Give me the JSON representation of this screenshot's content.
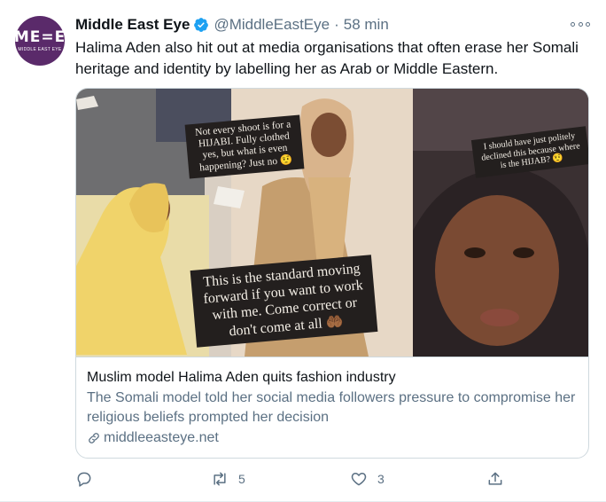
{
  "account": {
    "avatar_text": "ME=E",
    "avatar_subtext": "MIDDLE EAST EYE",
    "display_name": "Middle East Eye",
    "handle": "@MiddleEastEye",
    "separator": "·",
    "time": "58 min"
  },
  "tweet": {
    "text": "Halima Aden also hit out at media organisations that often erase her Somali heritage and identity by labelling her as Arab or Middle Eastern."
  },
  "card": {
    "quotes": {
      "q1": "Not every shoot is for a HIJABI. Fully clothed yes, but what is even happening? Just no 🤨",
      "q2": "I should have just politely declined this because where is the HIJAB? 🤨",
      "q3": "This is the standard moving forward if you want to work with me. Come correct or don't come at all 🤲🏾"
    },
    "title": "Muslim model Halima Aden quits fashion industry",
    "description": "The Somali model told her social media followers pressure to compromise her religious beliefs prompted her decision",
    "domain": "middleeasteye.net"
  },
  "actions": {
    "retweets": "5",
    "likes": "3"
  },
  "colors": {
    "verified": "#1da1f2",
    "secondary_text": "#5b7083",
    "avatar_bg": "#5a2a6a"
  }
}
